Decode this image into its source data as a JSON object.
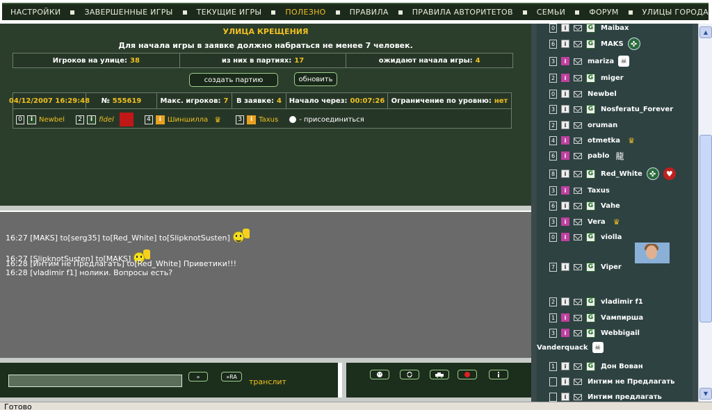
{
  "nav": {
    "items": [
      "НАСТРОЙКИ",
      "ЗАВЕРШЕННЫЕ ИГРЫ",
      "ТЕКУЩИЕ ИГРЫ",
      "ПОЛЕЗНО",
      "ПРАВИЛА",
      "ПРАВИЛА АВТОРИТЕТОВ",
      "СЕМЬИ",
      "ФОРУМ",
      "УЛИЦЫ ГОРОДА"
    ],
    "active_index": 3
  },
  "street": {
    "title": "УЛИЦА КРЕЩЕНИЯ",
    "notice": "Для начала игры в заявке должно набраться не менее 7 человек.",
    "stats": {
      "players_label": "Игроков на улице:",
      "players_value": "38",
      "in_games_label": "из них в партиях:",
      "in_games_value": "17",
      "waiting_label": "ожидают начала игры:",
      "waiting_value": "4"
    },
    "create_button": "создать партию",
    "refresh_button": "обновить"
  },
  "game": {
    "datetime": "04/12/2007 16:29:48",
    "number_label": "№",
    "number_value": "555619",
    "max_players_label": "Макс. игроков:",
    "max_players_value": "7",
    "in_queue_label": "В заявке:",
    "in_queue_value": "4",
    "start_label": "Начало через:",
    "start_value": "00:07:26",
    "level_limit_label": "Ограничение по уровню:",
    "level_limit_value": "нет",
    "players": [
      {
        "level": "0",
        "name": "Newbel",
        "italic": false,
        "info_orange": false
      },
      {
        "level": "2",
        "name": "fidel",
        "italic": true,
        "info_orange": false
      },
      {
        "level": "4",
        "name": "Шиншилла",
        "italic": false,
        "info_orange": true
      },
      {
        "level": "3",
        "name": "Taxus",
        "italic": false,
        "info_orange": true
      }
    ],
    "join_text": "- присоединиться"
  },
  "chat": {
    "lines": [
      "16:27 [MAKS] to[serg35] to[Red_White] to[SlipknotSusten]",
      "16:27 [SlipknotSusten] to[MAKS]",
      "16:28 [Интим не Предлагать] to[Red_White] Приветики!!!",
      "16:28 [vladimir f1] нолики. Вопросы есть?"
    ]
  },
  "input_bar": {
    "send_label": "»",
    "send_ru_label": "»RA",
    "translit_label": "транслит"
  },
  "users": [
    {
      "level": "0",
      "name": "Maibax",
      "info": "gray",
      "g": true
    },
    {
      "level": "6",
      "name": "MAKS",
      "info": "gray",
      "g": true,
      "badge": "cross"
    },
    {
      "level": "3",
      "name": "mariza",
      "info": "pink",
      "g": false,
      "badge": "skull"
    },
    {
      "level": "2",
      "name": "miger",
      "info": "pink",
      "g": true
    },
    {
      "level": "0",
      "name": "Newbel",
      "info": "gray",
      "g": false
    },
    {
      "level": "3",
      "name": "Nosferatu_Forever",
      "info": "gray",
      "g": true
    },
    {
      "level": "2",
      "name": "oruman",
      "info": "gray",
      "g": false
    },
    {
      "level": "4",
      "name": "otmetka",
      "info": "pink",
      "g": false,
      "badge": "crown"
    },
    {
      "level": "6",
      "name": "pablo",
      "info": "pink",
      "g": false,
      "badge": "pable"
    },
    {
      "level": "8",
      "name": "Red_White",
      "info": "gray",
      "g": true,
      "badge": "cross",
      "badge2": "red"
    },
    {
      "level": "3",
      "name": "Taxus",
      "info": "pink",
      "g": false
    },
    {
      "level": "6",
      "name": "Vahe",
      "info": "gray",
      "g": true
    },
    {
      "level": "3",
      "name": "Vera",
      "info": "pink",
      "g": false,
      "badge": "crown"
    },
    {
      "level": "0",
      "name": "violla",
      "info": "pink",
      "g": true
    },
    {
      "level": "7",
      "name": "Viper",
      "info": "gray",
      "g": true
    },
    {
      "level": "2",
      "name": "vladimir f1",
      "info": "gray",
      "g": true
    },
    {
      "level": "1",
      "name": "Vампирша",
      "info": "pink",
      "g": true
    },
    {
      "level": "3",
      "name": "Webbigail",
      "info": "pink",
      "g": true
    },
    {
      "level": "",
      "name": "Vanderquack",
      "info": "",
      "g": false,
      "badge": "skull"
    },
    {
      "level": "1",
      "name": "Дон Вован",
      "info": "gray",
      "g": true
    },
    {
      "level": "",
      "name": "Интим не Предлагать",
      "info": "gray",
      "g": false
    },
    {
      "level": "",
      "name": "Интим предлагать",
      "info": "gray",
      "g": false
    }
  ],
  "icons": {
    "crown": "♛",
    "cross": "✜",
    "red": "♥",
    "skull": "☠",
    "pable": "龍"
  },
  "status_bar": "Готово",
  "colors": {
    "accent": "#f0c020",
    "panel": "#2b3d2b",
    "chat_bg": "#6a6a6a"
  }
}
